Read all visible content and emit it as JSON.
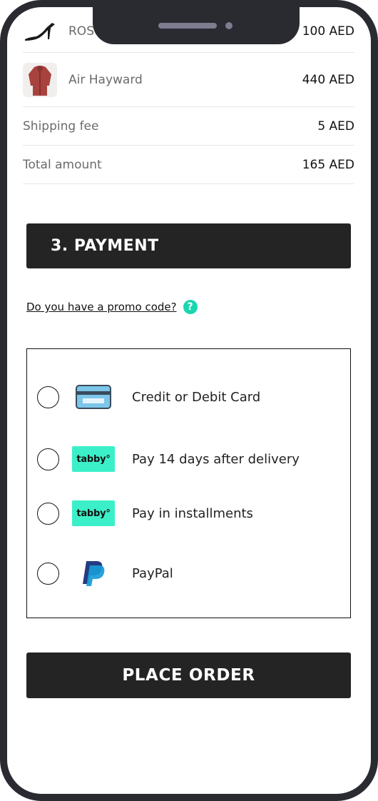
{
  "summary": {
    "items": [
      {
        "name": "ROS",
        "price": "100 AED",
        "thumb": "heel-shoe-image"
      },
      {
        "name": "Air Hayward",
        "price": "440 AED",
        "thumb": "jacket-image"
      }
    ],
    "shipping_label": "Shipping fee",
    "shipping_value": "5 AED",
    "total_label": "Total amount",
    "total_value": "165 AED"
  },
  "payment": {
    "header": "3. PAYMENT",
    "promo_link": "Do you have a promo code?",
    "help_glyph": "?",
    "methods": [
      {
        "label": "Credit or Debit Card",
        "icon": "credit-card-icon"
      },
      {
        "label": "Pay 14 days after delivery",
        "icon": "tabby-logo",
        "logo_text": "tabby°"
      },
      {
        "label": "Pay in installments",
        "icon": "tabby-logo",
        "logo_text": "tabby°"
      },
      {
        "label": "PayPal",
        "icon": "paypal-icon"
      }
    ]
  },
  "place_order": "PLACE ORDER",
  "colors": {
    "dark": "#242424",
    "tabby": "#3bf0c8",
    "help": "#19d6b0",
    "frame": "#2a2a31"
  }
}
